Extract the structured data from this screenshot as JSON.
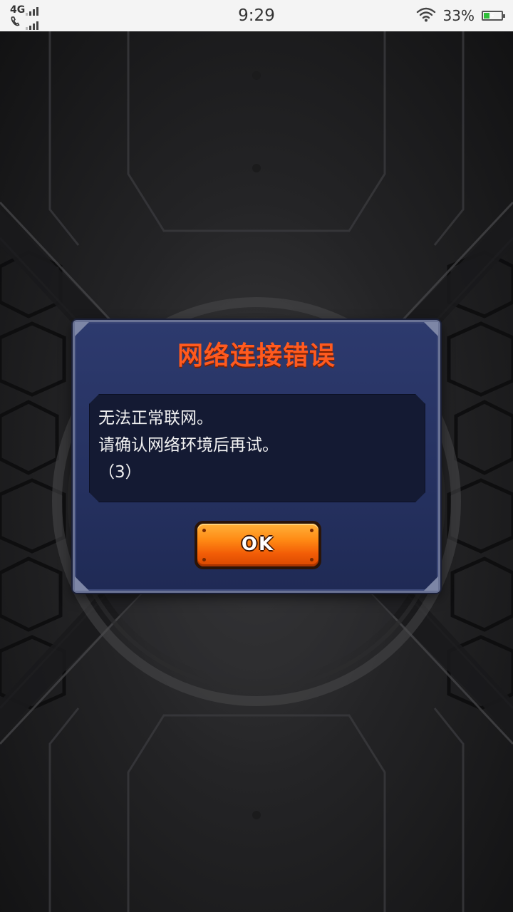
{
  "status_bar": {
    "network_type": "4G",
    "time": "9:29",
    "battery_percent": "33%",
    "battery_level": 0.33,
    "icons": [
      "signal-icon",
      "call-signal-icon",
      "wifi-icon",
      "battery-charging-icon"
    ]
  },
  "dialog": {
    "title": "网络连接错误",
    "message_lines": [
      "无法正常联网。",
      "请确认网络环境后再试。",
      "（3）"
    ],
    "ok_label": "OK"
  },
  "colors": {
    "title": "#ff5a1f",
    "dialog_bg": "#2a3566",
    "message_bg": "#141a33",
    "ok_button": "#ff8a14",
    "battery": "#2fbf3a"
  }
}
